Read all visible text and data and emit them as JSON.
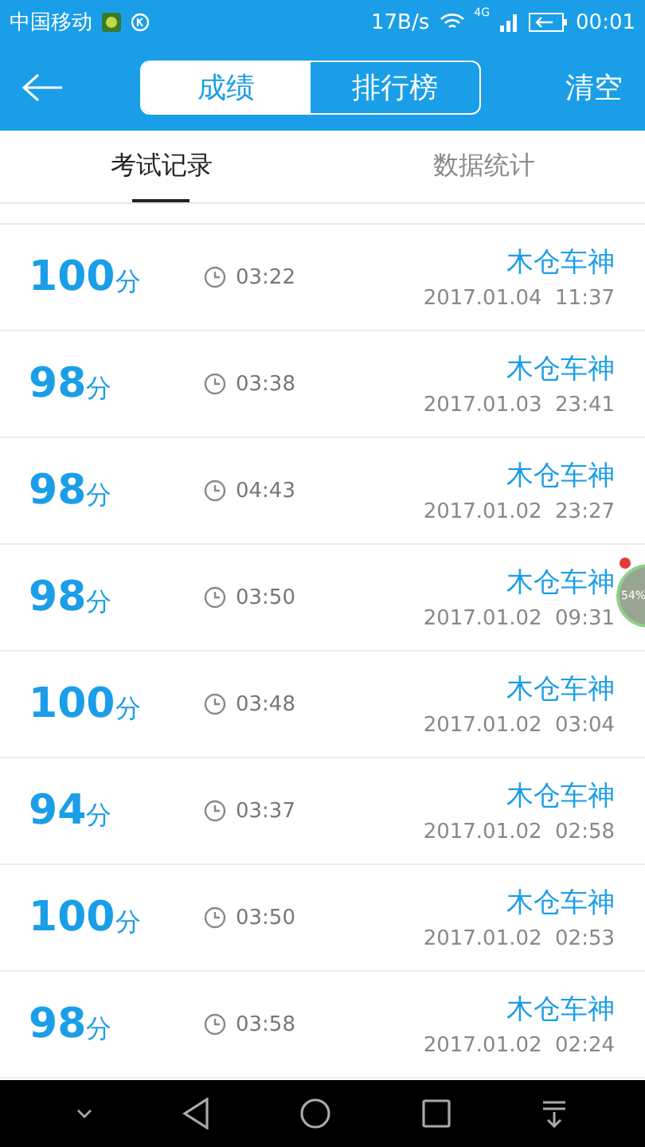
{
  "status_bar": {
    "carrier": "中国移动",
    "speed": "17B/s",
    "network": "4G",
    "time": "00:01"
  },
  "header": {
    "segments": [
      {
        "label": "成绩",
        "selected": true
      },
      {
        "label": "排行榜",
        "selected": false
      }
    ],
    "action": "清空"
  },
  "tabs": [
    {
      "label": "考试记录",
      "selected": true
    },
    {
      "label": "数据统计",
      "selected": false
    }
  ],
  "records": [
    {
      "score": "100",
      "unit": "分",
      "duration": "03:22",
      "name": "木仓车神",
      "date": "2017.01.04  11:37"
    },
    {
      "score": "98",
      "unit": "分",
      "duration": "03:38",
      "name": "木仓车神",
      "date": "2017.01.03  23:41"
    },
    {
      "score": "98",
      "unit": "分",
      "duration": "04:43",
      "name": "木仓车神",
      "date": "2017.01.02  23:27"
    },
    {
      "score": "98",
      "unit": "分",
      "duration": "03:50",
      "name": "木仓车神",
      "date": "2017.01.02  09:31"
    },
    {
      "score": "100",
      "unit": "分",
      "duration": "03:48",
      "name": "木仓车神",
      "date": "2017.01.02  03:04"
    },
    {
      "score": "94",
      "unit": "分",
      "duration": "03:37",
      "name": "木仓车神",
      "date": "2017.01.02  02:58"
    },
    {
      "score": "100",
      "unit": "分",
      "duration": "03:50",
      "name": "木仓车神",
      "date": "2017.01.02  02:53"
    },
    {
      "score": "98",
      "unit": "分",
      "duration": "03:58",
      "name": "木仓车神",
      "date": "2017.01.02  02:24"
    }
  ],
  "floating_bubble": {
    "label": "54%"
  }
}
